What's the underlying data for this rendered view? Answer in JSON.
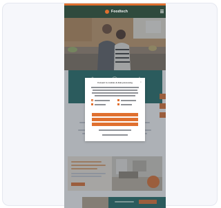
{
  "header": {
    "brand": "Foodtech",
    "menu_icon": "hamburger-menu-icon"
  },
  "modal": {
    "title": "Consent to cookies & data processing",
    "close_label": "×"
  },
  "colors": {
    "accent": "#e0702f",
    "header": "#2f4a3d",
    "panel": "#1f6b67",
    "overlay": "rgba(60,70,80,0.42)"
  },
  "icons": [
    "logo-mark-icon",
    "menu-icon",
    "feature-icon",
    "close-icon",
    "offer-badge-icon"
  ]
}
